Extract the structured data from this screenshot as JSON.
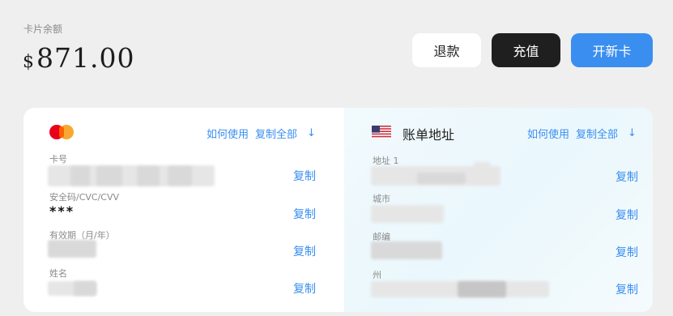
{
  "balance": {
    "label": "卡片余额",
    "currency": "$",
    "amount": "871.00"
  },
  "actions": {
    "refund": "退款",
    "topup": "充值",
    "new_card": "开新卡"
  },
  "card_panel": {
    "how_to_use": "如何使用",
    "copy_all": "复制全部",
    "download_icon": "↓",
    "fields": [
      {
        "label": "卡号",
        "copy": "复制"
      },
      {
        "label": "安全码/CVC/CVV",
        "value": "***",
        "copy": "复制"
      },
      {
        "label": "有效期（月/年）",
        "copy": "复制"
      },
      {
        "label": "姓名",
        "copy": "复制"
      }
    ]
  },
  "billing_panel": {
    "title": "账单地址",
    "how_to_use": "如何使用",
    "copy_all": "复制全部",
    "download_icon": "↓",
    "fields": [
      {
        "label": "地址 1",
        "copy": "复制"
      },
      {
        "label": "城市",
        "copy": "复制"
      },
      {
        "label": "邮编",
        "copy": "复制"
      },
      {
        "label": "州",
        "copy": "复制"
      }
    ]
  },
  "colors": {
    "accent": "#3a8ef0",
    "dark_button": "#1f1f1f",
    "background": "#efefef"
  }
}
